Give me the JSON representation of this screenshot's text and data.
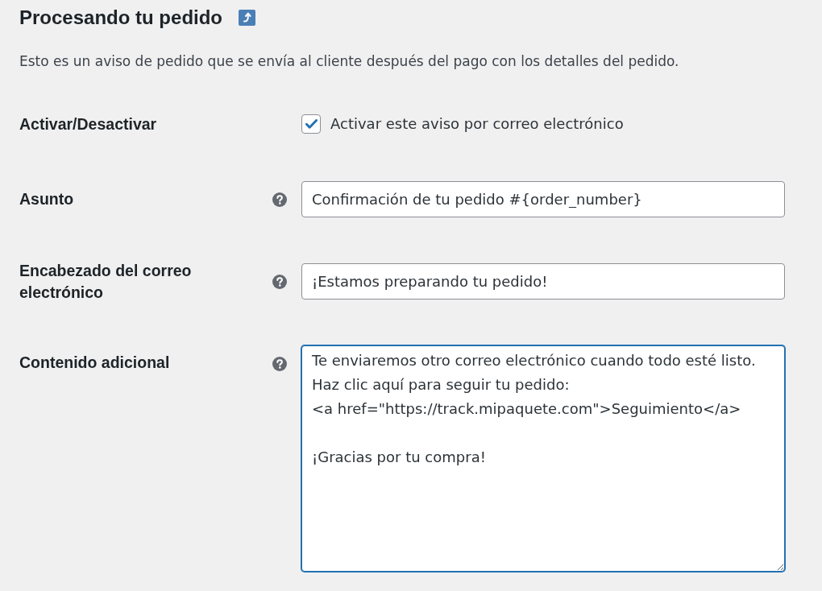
{
  "title": "Procesando tu pedido",
  "description": "Esto es un aviso de pedido que se envía al cliente después del pago con los detalles del pedido.",
  "settings": [
    {
      "kind": "checkbox",
      "label": "Activar/Desactivar",
      "help_tip": false,
      "checked": true,
      "checkbox_label": "Activar este aviso por correo electrónico"
    },
    {
      "kind": "text",
      "label": "Asunto",
      "help_tip": true,
      "value": "Confirmación de tu pedido #{order_number}"
    },
    {
      "kind": "text",
      "label": "Encabezado del correo electrónico",
      "help_tip": true,
      "value": "¡Estamos preparando tu pedido!"
    },
    {
      "kind": "textarea",
      "label": "Contenido adicional",
      "help_tip": true,
      "focused": true,
      "value": "Te enviaremos otro correo electrónico cuando todo esté listo.\nHaz clic aquí para seguir tu pedido:\n<a href=\"https://track.mipaquete.com\">Seguimiento</a>\n\n¡Gracias por tu compra!"
    }
  ]
}
